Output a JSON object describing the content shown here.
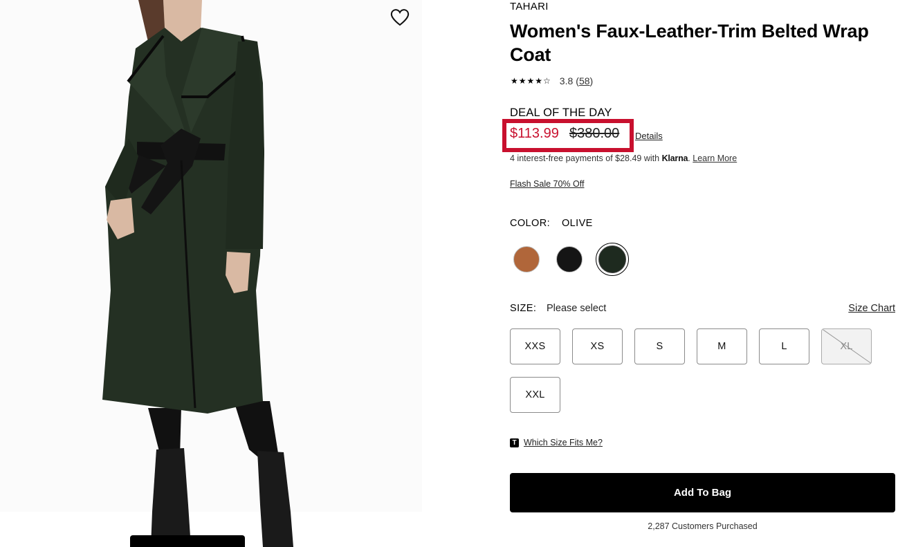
{
  "product": {
    "brand": "TAHARI",
    "title": "Women's Faux-Leather-Trim Belted Wrap Coat",
    "rating": {
      "stars_icon": "star-rating-icon",
      "stars_glyphs": "★★★★☆",
      "value": "3.8",
      "count": "58",
      "count_open": "(",
      "count_close": ")"
    }
  },
  "pricing": {
    "deal_label": "DEAL OF THE DAY",
    "sale_price": "$113.99",
    "original_price": "$380.00",
    "details_link": "Details",
    "highlight_color": "#c8102e",
    "klarna_prefix": "4 interest-free payments of $28.49 with ",
    "klarna_brand": "Klarna",
    "klarna_dot": ".",
    "klarna_learn_more": "Learn More",
    "flash_sale": "Flash Sale 70% Off"
  },
  "color": {
    "label": "COLOR:",
    "selected": "OLIVE",
    "swatches": [
      {
        "name": "brown",
        "hex": "#b0663a"
      },
      {
        "name": "black",
        "hex": "#151515"
      },
      {
        "name": "olive",
        "hex": "#1e2a1f",
        "selected": true
      }
    ]
  },
  "size": {
    "label": "SIZE:",
    "placeholder": "Please select",
    "chart_link": "Size Chart",
    "options": [
      {
        "label": "XXS",
        "available": true
      },
      {
        "label": "XS",
        "available": true
      },
      {
        "label": "S",
        "available": true
      },
      {
        "label": "M",
        "available": true
      },
      {
        "label": "L",
        "available": true
      },
      {
        "label": "XL",
        "available": false
      },
      {
        "label": "XXL",
        "available": true
      }
    ],
    "fit_icon": "T",
    "fit_link": "Which Size Fits Me?"
  },
  "actions": {
    "add_to_bag": "Add To Bag",
    "purchased": "2,287 Customers Purchased"
  },
  "icons": {
    "wishlist": "heart-outline-icon"
  }
}
